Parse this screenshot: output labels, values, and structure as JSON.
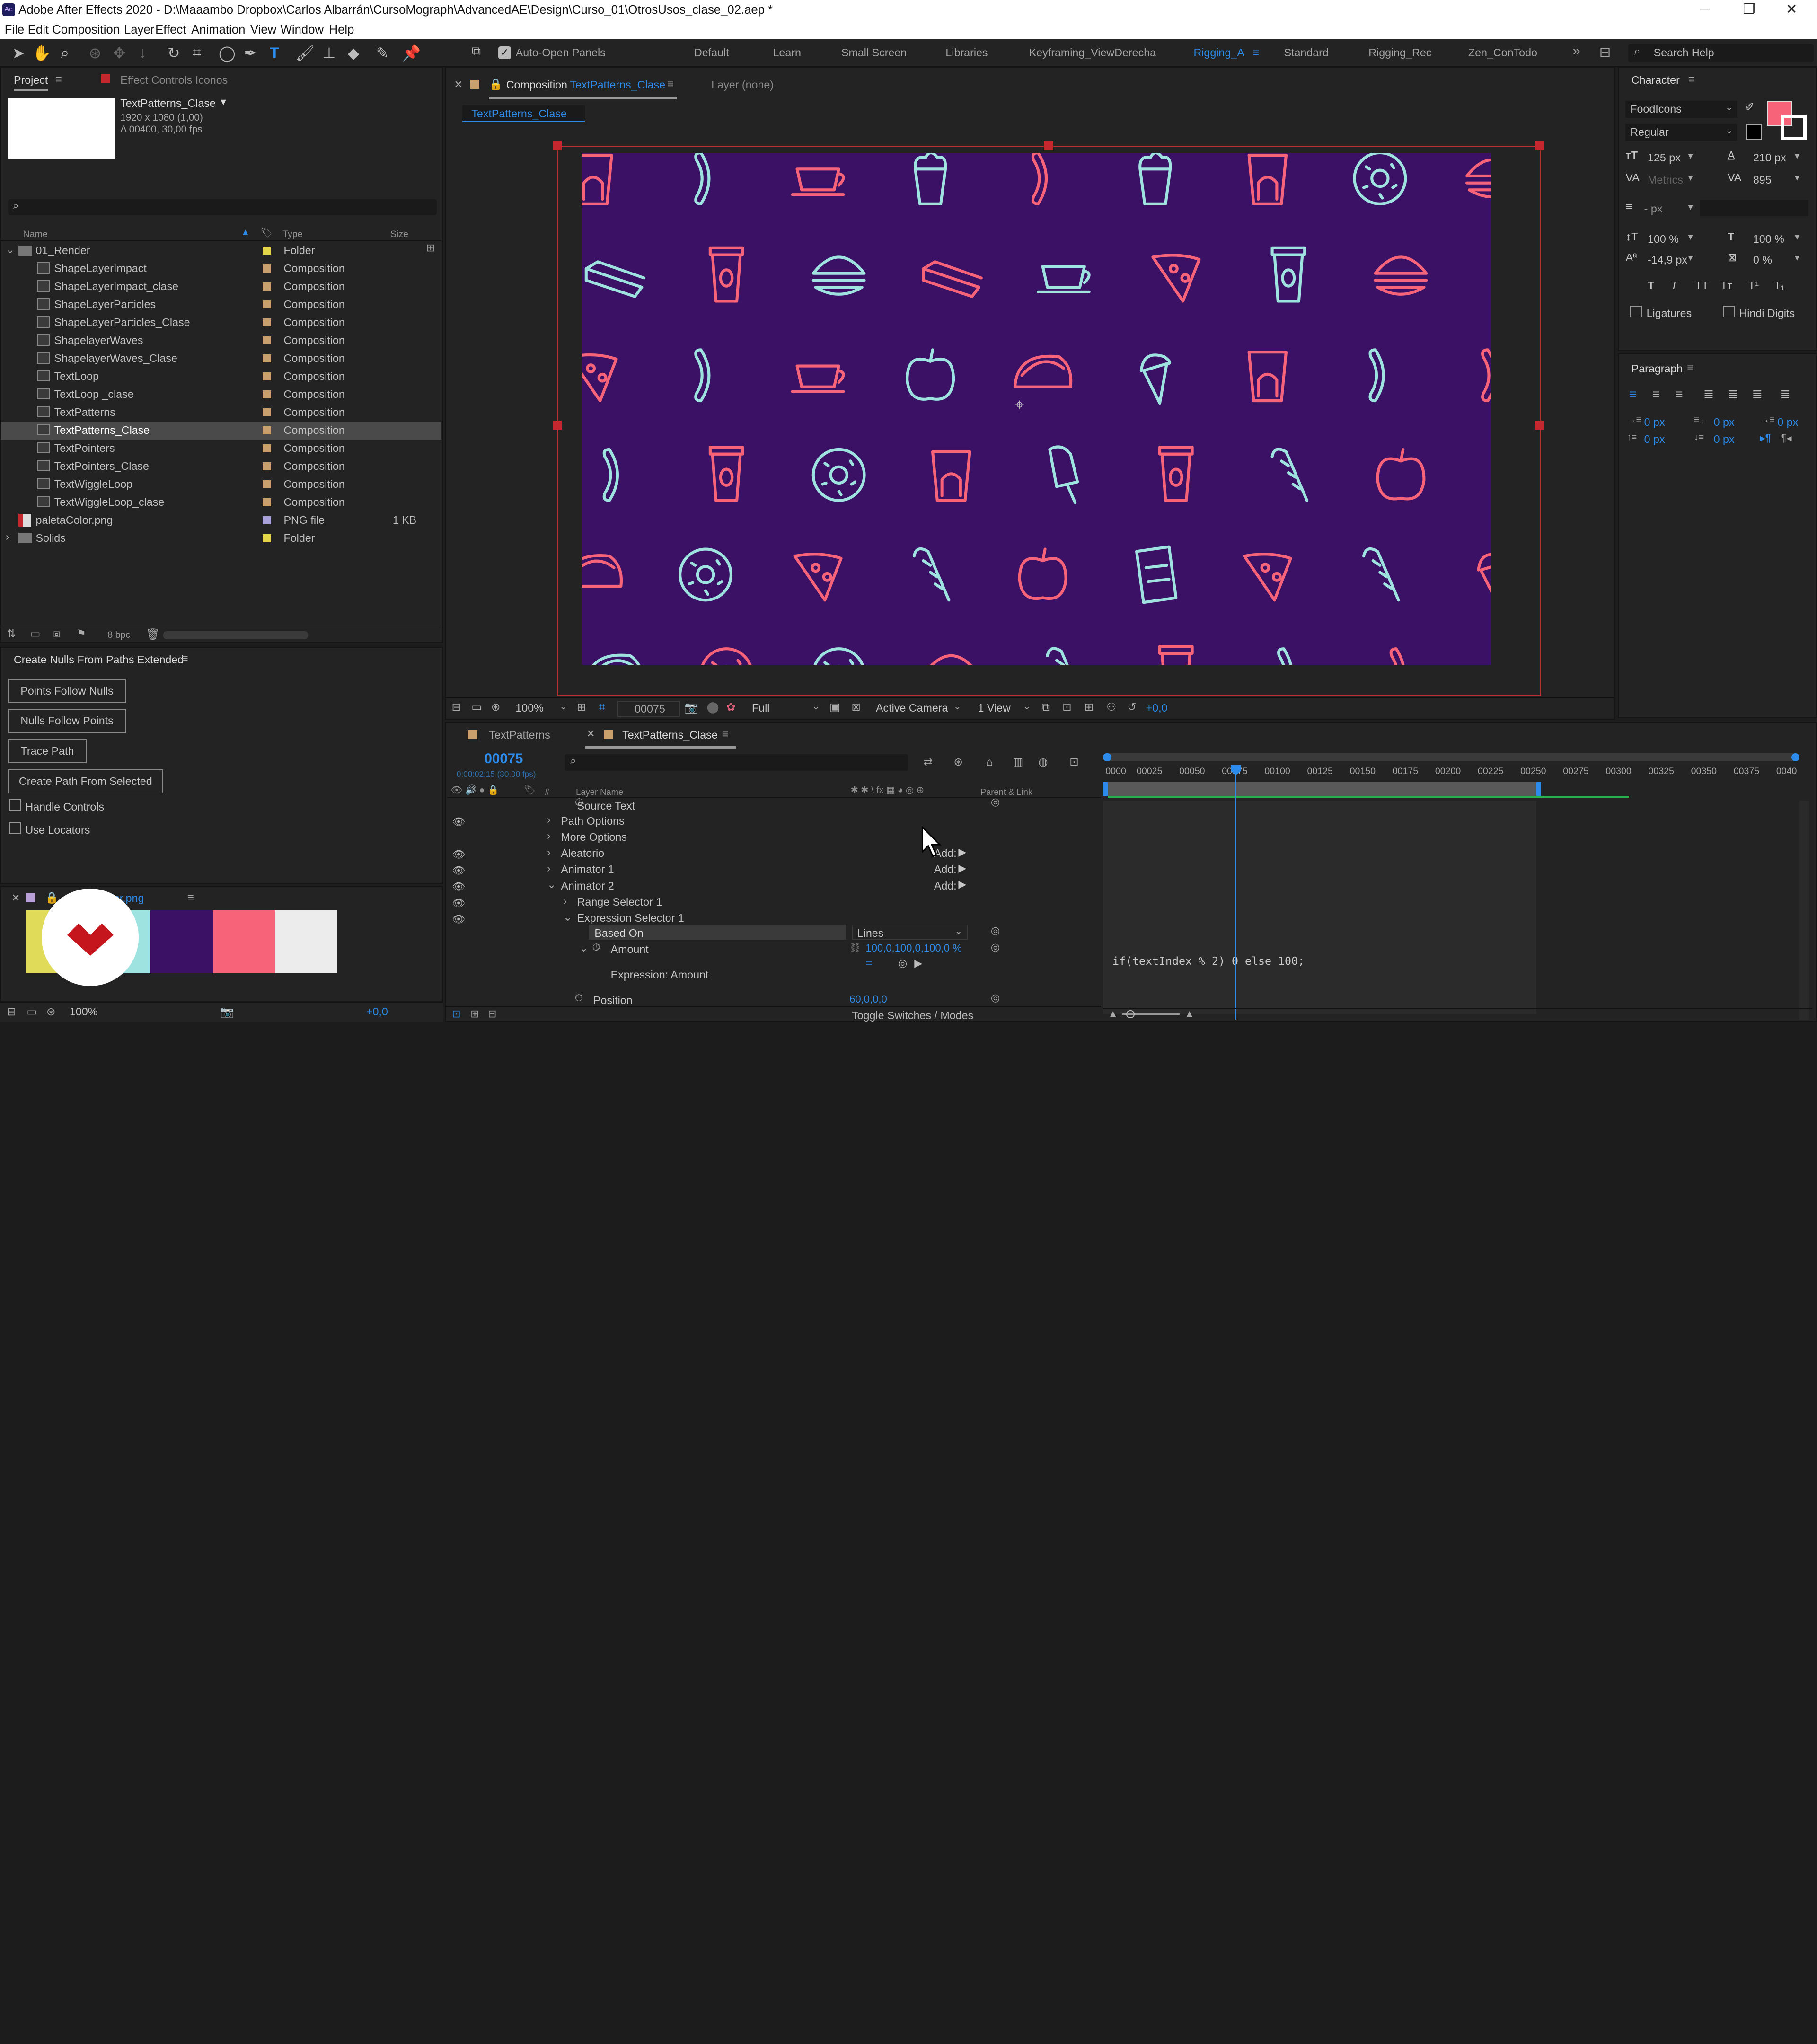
{
  "app": {
    "title": "Adobe After Effects 2020 - D:\\Maaambo Dropbox\\Carlos Albarrán\\CursoMograph\\AdvancedAE\\Design\\Curso_01\\OtrosUsos_clase_02.aep *",
    "icon_label": "Ae"
  },
  "menu": [
    "File",
    "Edit",
    "Composition",
    "Layer",
    "Effect",
    "Animation",
    "View",
    "Window",
    "Help"
  ],
  "toolbar": {
    "auto_open": "Auto-Open Panels",
    "search_help": "Search Help"
  },
  "workspaces": [
    "Default",
    "Learn",
    "Small Screen",
    "Libraries",
    "Keyframing_ViewDerecha",
    "Rigging_A",
    "Standard",
    "Rigging_Rec",
    "Zen_ConTodo"
  ],
  "active_workspace": "Rigging_A",
  "project": {
    "tab": "Project",
    "tab2": "Effect Controls Iconos",
    "comp_name": "TextPatterns_Clase",
    "comp_info1": "1920 x 1080 (1,00)",
    "comp_info2": "Δ 00400, 30,00 fps",
    "col_name": "Name",
    "col_type": "Type",
    "col_size": "Size",
    "items": [
      {
        "name": "01_Render",
        "type": "Folder",
        "size": "",
        "kind": "folder"
      },
      {
        "name": "ShapeLayerImpact",
        "type": "Composition",
        "size": "",
        "kind": "comp"
      },
      {
        "name": "ShapeLayerImpact_clase",
        "type": "Composition",
        "size": "",
        "kind": "comp"
      },
      {
        "name": "ShapeLayerParticles",
        "type": "Composition",
        "size": "",
        "kind": "comp"
      },
      {
        "name": "ShapeLayerParticles_Clase",
        "type": "Composition",
        "size": "",
        "kind": "comp"
      },
      {
        "name": "ShapelayerWaves",
        "type": "Composition",
        "size": "",
        "kind": "comp"
      },
      {
        "name": "ShapelayerWaves_Clase",
        "type": "Composition",
        "size": "",
        "kind": "comp"
      },
      {
        "name": "TextLoop",
        "type": "Composition",
        "size": "",
        "kind": "comp"
      },
      {
        "name": "TextLoop _clase",
        "type": "Composition",
        "size": "",
        "kind": "comp"
      },
      {
        "name": "TextPatterns",
        "type": "Composition",
        "size": "",
        "kind": "comp"
      },
      {
        "name": "TextPatterns_Clase",
        "type": "Composition",
        "size": "",
        "kind": "comp",
        "selected": true
      },
      {
        "name": "TextPointers",
        "type": "Composition",
        "size": "",
        "kind": "comp"
      },
      {
        "name": "TextPointers_Clase",
        "type": "Composition",
        "size": "",
        "kind": "comp"
      },
      {
        "name": "TextWiggleLoop",
        "type": "Composition",
        "size": "",
        "kind": "comp"
      },
      {
        "name": "TextWiggleLoop_clase",
        "type": "Composition",
        "size": "",
        "kind": "comp"
      },
      {
        "name": "paletaColor.png",
        "type": "PNG file",
        "size": "1 KB",
        "kind": "png"
      },
      {
        "name": "Solids",
        "type": "Folder",
        "size": "",
        "kind": "folder"
      }
    ],
    "bpc": "8 bpc"
  },
  "script_panel": {
    "title": "Create Nulls From Paths Extended",
    "buttons": [
      "Points Follow Nulls",
      "Nulls Follow Points",
      "Trace Path",
      "Create Path From Selected"
    ],
    "checks": [
      "Handle Controls",
      "Use Locators"
    ]
  },
  "footage_panel": {
    "name": "paletaColor.png",
    "swatches": [
      "#e0dc5a",
      "#9fe3e0",
      "#3b1166",
      "#f7647a",
      "#ececec"
    ]
  },
  "comp_panel": {
    "tab": "Composition",
    "comp": "TextPatterns_Clase",
    "layer_tab": "Layer (none)",
    "crumb": "TextPatterns_Clase",
    "zoom": "100%",
    "timecode": "00075",
    "resolution": "Full",
    "camera": "Active Camera",
    "views": "1 View",
    "exposure": "+0,0"
  },
  "character": {
    "title": "Character",
    "font": "FoodIcons",
    "style": "Regular",
    "size": "125 px",
    "leading": "210 px",
    "kerning": "Metrics",
    "tracking": "895",
    "stroke": "- px",
    "vscale": "100 %",
    "hscale": "100 %",
    "baseline": "-14,9 px",
    "tsume": "0 %",
    "ligatures": "Ligatures",
    "hindi": "Hindi Digits",
    "fill_color": "#f7647a"
  },
  "paragraph": {
    "title": "Paragraph",
    "indent1": "0 px",
    "indent2": "0 px",
    "indent3": "0 px",
    "space1": "0 px",
    "space2": "0 px"
  },
  "timeline": {
    "tabs": [
      "TextPatterns",
      "TextPatterns_Clase"
    ],
    "timecode": "00075",
    "timecode_sub": "0:00:02:15 (30.00 fps)",
    "col_layer": "Layer Name",
    "col_parent": "Parent & Link",
    "ruler": [
      "0000",
      "00025",
      "00050",
      "00075",
      "00100",
      "00125",
      "00150",
      "00175",
      "00200",
      "00225",
      "00250",
      "00275",
      "00300",
      "00325",
      "00350",
      "00375",
      "0040"
    ],
    "rows": [
      {
        "label": "Source Text",
        "indent": 1,
        "eye": false,
        "twirl": "",
        "add": ""
      },
      {
        "label": "Path Options",
        "indent": 0,
        "eye": true,
        "twirl": "›",
        "add": ""
      },
      {
        "label": "More Options",
        "indent": 0,
        "eye": false,
        "twirl": "›",
        "add": ""
      },
      {
        "label": "Aleatorio",
        "indent": 0,
        "eye": true,
        "twirl": "›",
        "add": "Add:"
      },
      {
        "label": "Animator 1",
        "indent": 0,
        "eye": true,
        "twirl": "›",
        "add": "Add:"
      },
      {
        "label": "Animator 2",
        "indent": 0,
        "eye": true,
        "twirl": "⌄",
        "add": "Add:"
      },
      {
        "label": "Range Selector 1",
        "indent": 1,
        "eye": true,
        "twirl": "›",
        "add": ""
      },
      {
        "label": "Expression Selector 1",
        "indent": 1,
        "eye": true,
        "twirl": "⌄",
        "add": ""
      },
      {
        "label": "Based On",
        "indent": 2,
        "eye": false,
        "twirl": "",
        "add": ""
      }
    ],
    "based_on_value": "Lines",
    "amount_label": "Amount",
    "amount_value": "100,0,100,0,100,0 %",
    "expr_label": "Expression: Amount",
    "expression": "if(textIndex % 2) 0 else 100;",
    "position_label": "Position",
    "position_value": "60,0,0,0",
    "toggle": "Toggle Switches / Modes"
  }
}
